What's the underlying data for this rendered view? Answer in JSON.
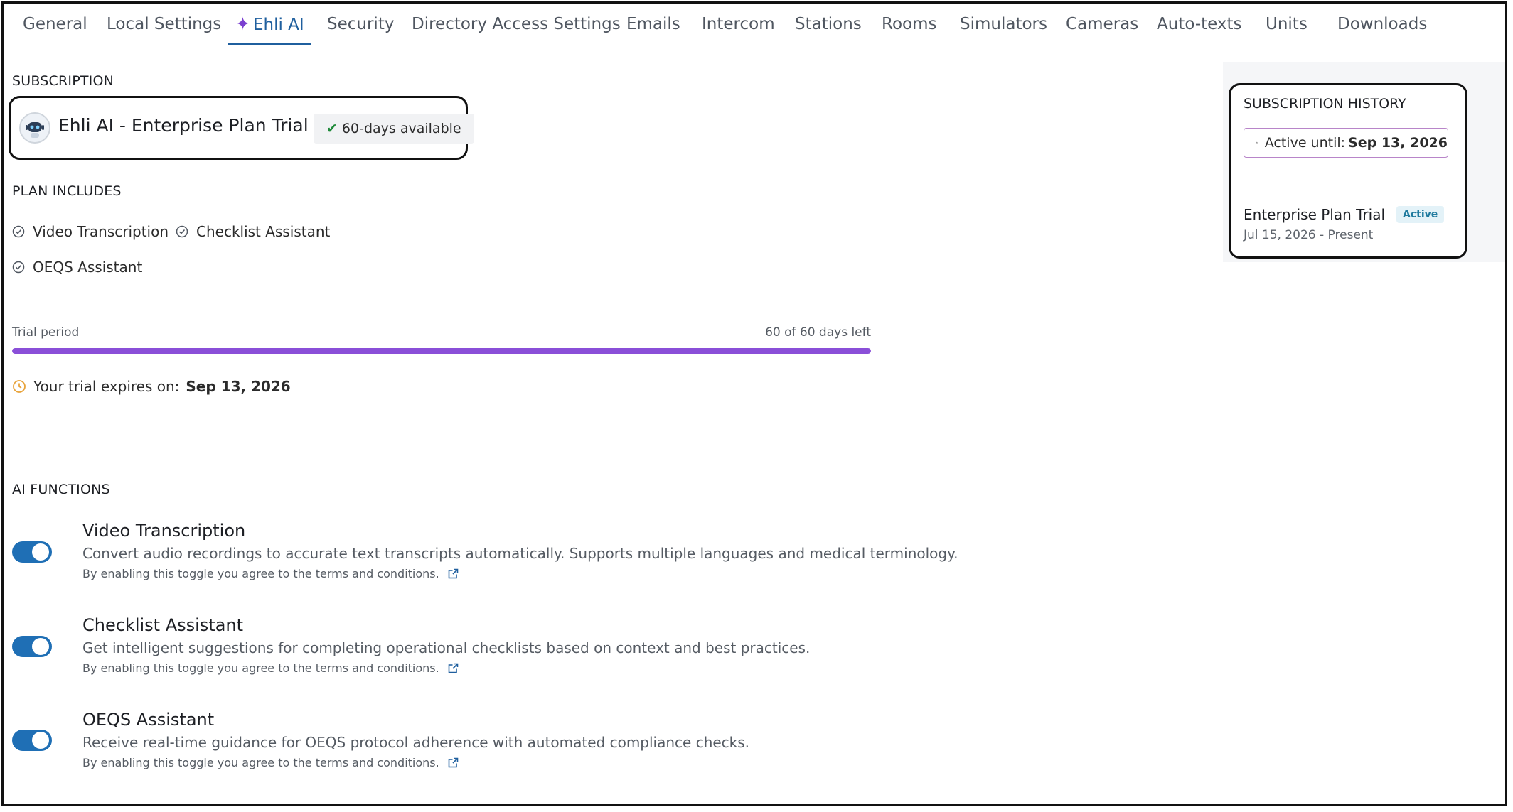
{
  "tabs": [
    {
      "label": "General"
    },
    {
      "label": "Local Settings"
    },
    {
      "label": "Ehli AI",
      "active": true
    },
    {
      "label": "Security"
    },
    {
      "label": "Directory Access Settings"
    },
    {
      "label": "Emails"
    },
    {
      "label": "Intercom"
    },
    {
      "label": "Stations"
    },
    {
      "label": "Rooms"
    },
    {
      "label": "Simulators"
    },
    {
      "label": "Cameras"
    },
    {
      "label": "Auto-texts"
    },
    {
      "label": "Units"
    },
    {
      "label": "Downloads"
    }
  ],
  "subscription": {
    "section_title": "SUBSCRIPTION",
    "plan_name": "Ehli AI - Enterprise Plan Trial",
    "availability": "60-days available"
  },
  "plan_includes": {
    "section_title": "PLAN INCLUDES",
    "items": [
      "Video Transcription",
      "Checklist Assistant",
      "OEQS Assistant"
    ]
  },
  "trial": {
    "label": "Trial period",
    "days_text": "60 of 60 days left",
    "progress_fraction": 1.0,
    "expires_label": "Your trial expires on:",
    "expires_date": "Sep 13, 2026"
  },
  "ai_functions": {
    "section_title": "AI FUNCTIONS",
    "items": [
      {
        "title": "Video Transcription",
        "description": "Convert audio recordings to accurate text transcripts automatically. Supports multiple languages and medical terminology.",
        "terms": "By enabling this toggle you agree to the terms and conditions.",
        "enabled": true
      },
      {
        "title": "Checklist Assistant",
        "description": "Get intelligent suggestions for completing operational checklists based on context and best practices.",
        "terms": "By enabling this toggle you agree to the terms and conditions.",
        "enabled": true
      },
      {
        "title": "OEQS Assistant",
        "description": "Receive real-time guidance for OEQS protocol adherence with automated compliance checks.",
        "terms": "By enabling this toggle you agree to the terms and conditions.",
        "enabled": true
      }
    ]
  },
  "history": {
    "title": "SUBSCRIPTION HISTORY",
    "active_until_label": "Active until:",
    "active_until_date": "Sep 13, 2026",
    "entry_plan": "Enterprise Plan Trial",
    "entry_status": "Active",
    "entry_dates": "Jul 15, 2026 - Present"
  },
  "colors": {
    "accent": "#1f5f9e",
    "progress": "#8a4fd8",
    "toggle_on": "#1f6fb5",
    "check_green": "#1f8a3a",
    "clock_orange": "#e8a33a"
  },
  "icons": [
    "sparkle-icon",
    "robot-avatar-icon",
    "checkmark-icon",
    "circle-check-icon",
    "clock-icon",
    "external-link-icon",
    "calendar-check-icon"
  ]
}
